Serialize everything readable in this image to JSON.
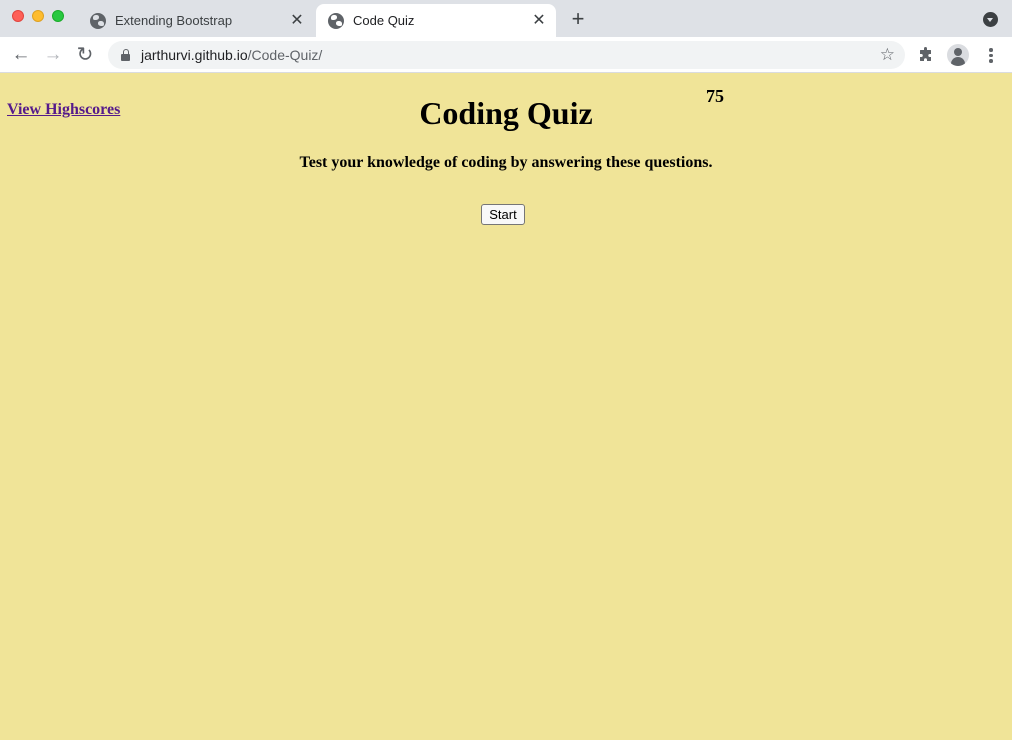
{
  "browser": {
    "tabs": [
      {
        "title": "Extending Bootstrap",
        "active": false,
        "close": "✕"
      },
      {
        "title": "Code Quiz",
        "active": true,
        "close": "✕"
      }
    ],
    "new_tab": "+",
    "url_host": "jarthurvi.github.io",
    "url_path": "/Code-Quiz/",
    "icons": {
      "back": "arrow-left-icon",
      "forward": "arrow-right-icon",
      "reload": "reload-icon",
      "bookmark": "star-icon",
      "extensions": "puzzle-icon",
      "profile": "profile-icon",
      "menu": "kebab-menu-icon"
    },
    "glyphs": {
      "back": "←",
      "forward": "→",
      "reload": "↻",
      "star": "☆"
    }
  },
  "page": {
    "highscores_link": "View Highscores",
    "timer": "75",
    "title": "Coding Quiz",
    "subtitle": "Test your knowledge of coding by answering these questions.",
    "start_button": "Start",
    "background_color": "#f0e498",
    "link_color": "#551a8b"
  }
}
